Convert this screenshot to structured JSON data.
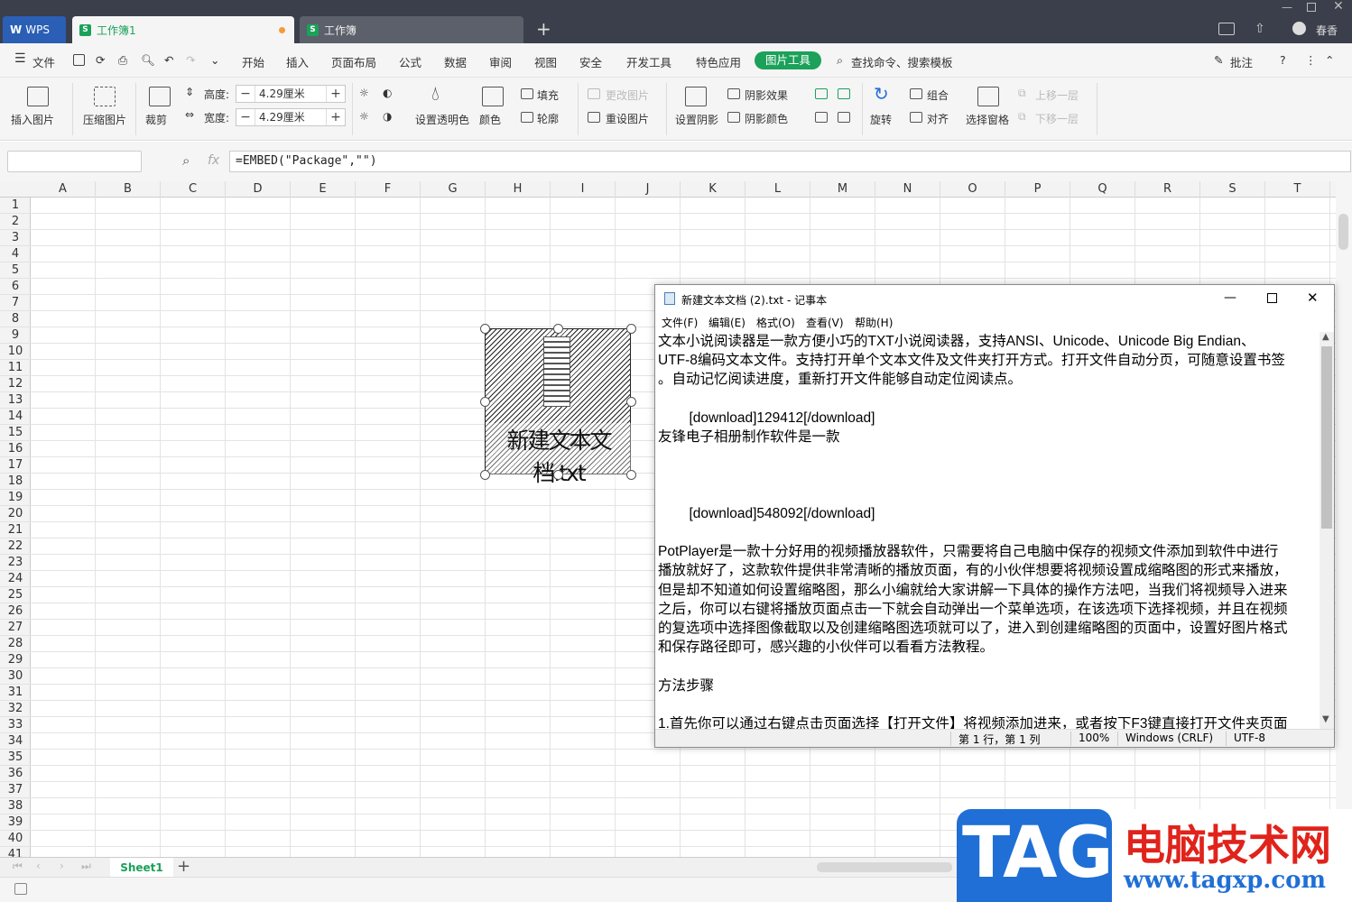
{
  "window": {
    "app_tab": "WPS",
    "tab1": "工作簿1",
    "tab2": "工作簿",
    "user": "春香",
    "new_tab": "+"
  },
  "menu": {
    "file": "文件",
    "items": [
      "开始",
      "插入",
      "页面布局",
      "公式",
      "数据",
      "审阅",
      "视图",
      "安全",
      "开发工具",
      "特色应用"
    ],
    "active": "图片工具",
    "search": "查找命令、搜索模板",
    "comment": "批注"
  },
  "ribbon": {
    "insert_picture": "插入图片",
    "compress": "压缩图片",
    "crop": "裁剪",
    "height_label": "高度:",
    "width_label": "宽度:",
    "height_value": "4.29厘米",
    "width_value": "4.29厘米",
    "transparent": "设置透明色",
    "color": "颜色",
    "fill": "填充",
    "outline": "轮廓",
    "change_picture": "更改图片",
    "reset_picture": "重设图片",
    "shadow": "设置阴影",
    "shadow_effect": "阴影效果",
    "shadow_color": "阴影颜色",
    "rotate": "旋转",
    "group": "组合",
    "align": "对齐",
    "selection_pane": "选择窗格",
    "bring_forward": "上移一层",
    "send_backward": "下移一层"
  },
  "formula": {
    "fx": "fx",
    "value": "=EMBED(\"Package\",\"\")"
  },
  "grid": {
    "columns": [
      "A",
      "B",
      "C",
      "D",
      "E",
      "F",
      "G",
      "H",
      "I",
      "J",
      "K",
      "L",
      "M",
      "N",
      "O",
      "P",
      "Q",
      "R",
      "S",
      "T"
    ],
    "rows": [
      "1",
      "2",
      "3",
      "4",
      "5",
      "6",
      "7",
      "8",
      "9",
      "10",
      "11",
      "12",
      "13",
      "14",
      "15",
      "16",
      "17",
      "18",
      "19",
      "20",
      "21",
      "22",
      "23",
      "24",
      "25",
      "26",
      "27",
      "28",
      "29",
      "30",
      "31",
      "32",
      "33",
      "34",
      "35",
      "36",
      "37",
      "38",
      "39",
      "40",
      "41"
    ]
  },
  "object": {
    "label": "新建文本文档.txt"
  },
  "sheets": {
    "active": "Sheet1",
    "add": "+"
  },
  "notepad": {
    "title": "新建文本文档 (2).txt - 记事本",
    "menu": [
      "文件(F)",
      "编辑(E)",
      "格式(O)",
      "查看(V)",
      "帮助(H)"
    ],
    "text": "文本小说阅读器是一款方便小巧的TXT小说阅读器，支持ANSI、Unicode、Unicode Big Endian、\nUTF-8编码文本文件。支持打开单个文本文件及文件夹打开方式。打开文件自动分页，可随意设置书签\n。自动记忆阅读进度，重新打开文件能够自动定位阅读点。\n\n        [download]129412[/download]\n友锋电子相册制作软件是一款\n\n\n\n        [download]548092[/download]\n\nPotPlayer是一款十分好用的视频播放器软件，只需要将自己电脑中保存的视频文件添加到软件中进行\n播放就好了，这款软件提供非常清晰的播放页面，有的小伙伴想要将视频设置成缩略图的形式来播放，\n但是却不知道如何设置缩略图，那么小编就给大家讲解一下具体的操作方法吧，当我们将视频导入进来\n之后，你可以右键将播放页面点击一下就会自动弹出一个菜单选项，在该选项下选择视频，并且在视频\n的复选项中选择图像截取以及创建缩略图选项就可以了，进入到创建缩略图的页面中，设置好图片格式\n和保存路径即可，感兴趣的小伙伴可以看看方法教程。\n\n方法步骤\n\n1.首先你可以通过右键点击页面选择【打开文件】将视频添加进来，或者按下F3键直接打开文件夹页面",
    "status_pos": "第 1 行，第 1 列",
    "zoom": "100%",
    "eol": "Windows (CRLF)",
    "encoding": "UTF-8"
  },
  "watermark": {
    "tag": "TAG",
    "cn": "电脑技术网",
    "url": "www.tagxp.com"
  }
}
